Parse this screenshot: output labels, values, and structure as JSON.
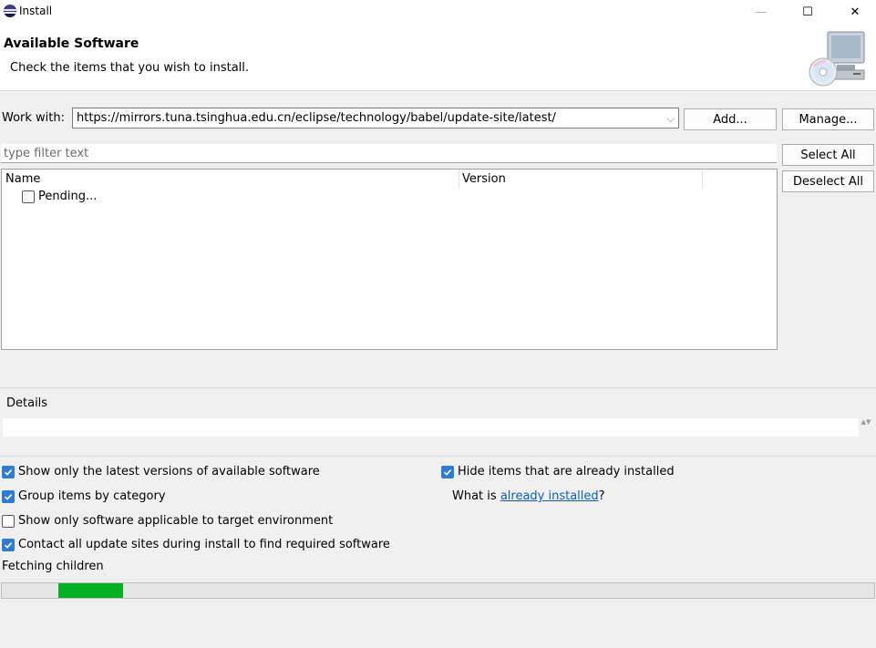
{
  "window": {
    "title": "Install",
    "controls": {
      "minimize": "—",
      "maximize": "☐",
      "close": "✕"
    }
  },
  "header": {
    "title": "Available Software",
    "description": "Check the items that you wish to install.",
    "image_icon": "monitor-cd-icon"
  },
  "work_with": {
    "label": "Work with:",
    "value": "https://mirrors.tuna.tsinghua.edu.cn/eclipse/technology/babel/update-site/latest/",
    "dropdown_icon": "chevron-down-icon",
    "dropdown_glyph": "⌵",
    "add_label": "Add...",
    "manage_label": "Manage..."
  },
  "filter": {
    "placeholder": "type filter text",
    "select_all_label": "Select All",
    "deselect_all_label": "Deselect All"
  },
  "tree": {
    "columns": [
      "Name",
      "Version"
    ],
    "rows": [
      {
        "label": "Pending...",
        "checked": false
      }
    ]
  },
  "details": {
    "label": "Details",
    "value": "",
    "scroll_glyph": "▲▼"
  },
  "options": {
    "show_latest": {
      "label": "Show only the latest versions of available software",
      "checked": true
    },
    "group_by_category": {
      "label": "Group items by category",
      "checked": true
    },
    "target_env": {
      "label": "Show only software applicable to target environment",
      "checked": false
    },
    "contact_sites": {
      "label": "Contact all update sites during install to find required software",
      "checked": true
    },
    "hide_installed": {
      "label": "Hide items that are already installed",
      "checked": true
    },
    "what_is": {
      "prefix": "What is ",
      "link": "already installed",
      "suffix": "?"
    }
  },
  "progress": {
    "status": "Fetching children",
    "fill_color": "#06b025",
    "indeterminate": true
  },
  "colors": {
    "accent": "#2d7bd6",
    "link": "#0b5cc9"
  }
}
